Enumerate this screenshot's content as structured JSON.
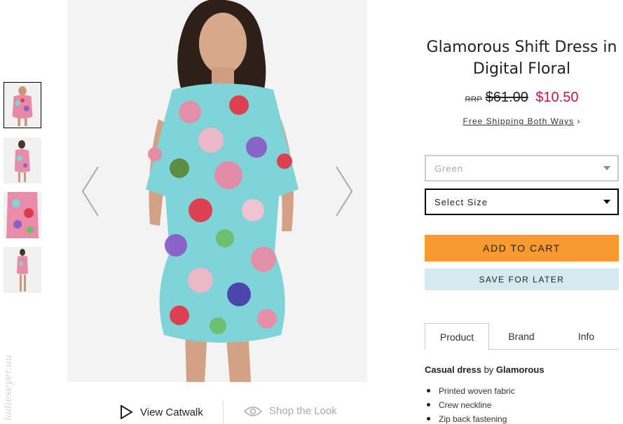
{
  "gallery": {
    "thumbnails": [
      {
        "label": "Front view",
        "selected": true
      },
      {
        "label": "Side view",
        "selected": false
      },
      {
        "label": "Back detail",
        "selected": false
      },
      {
        "label": "Full length",
        "selected": false
      }
    ]
  },
  "actions": {
    "catwalk_label": "View Catwalk",
    "look_label": "Shop the Look"
  },
  "watermark": "ladieseyer.uu",
  "product": {
    "title_line1": "Glamorous Shift Dress in",
    "title_line2": "Digital Floral",
    "rrp_label": "RRP",
    "old_price": "$61.00",
    "new_price": "$10.50",
    "shipping_text": "Free Shipping Both Ways",
    "shipping_chevron": "›"
  },
  "selectors": {
    "color_value": "Green",
    "size_value": "Select Size"
  },
  "buttons": {
    "add_to_cart": "ADD TO CART",
    "save_for_later": "SAVE FOR LATER"
  },
  "tabs": [
    {
      "label": "Product",
      "active": true
    },
    {
      "label": "Brand",
      "active": false
    },
    {
      "label": "Info",
      "active": false
    }
  ],
  "description": {
    "type": "Casual dress",
    "by": "by",
    "brand": "Glamorous"
  },
  "details": [
    "Printed woven fabric",
    "Crew neckline",
    "Zip back fastening"
  ],
  "colors": {
    "accent_price": "#d01345",
    "cart_button": "#f99a31",
    "save_button": "#d4eaee"
  }
}
